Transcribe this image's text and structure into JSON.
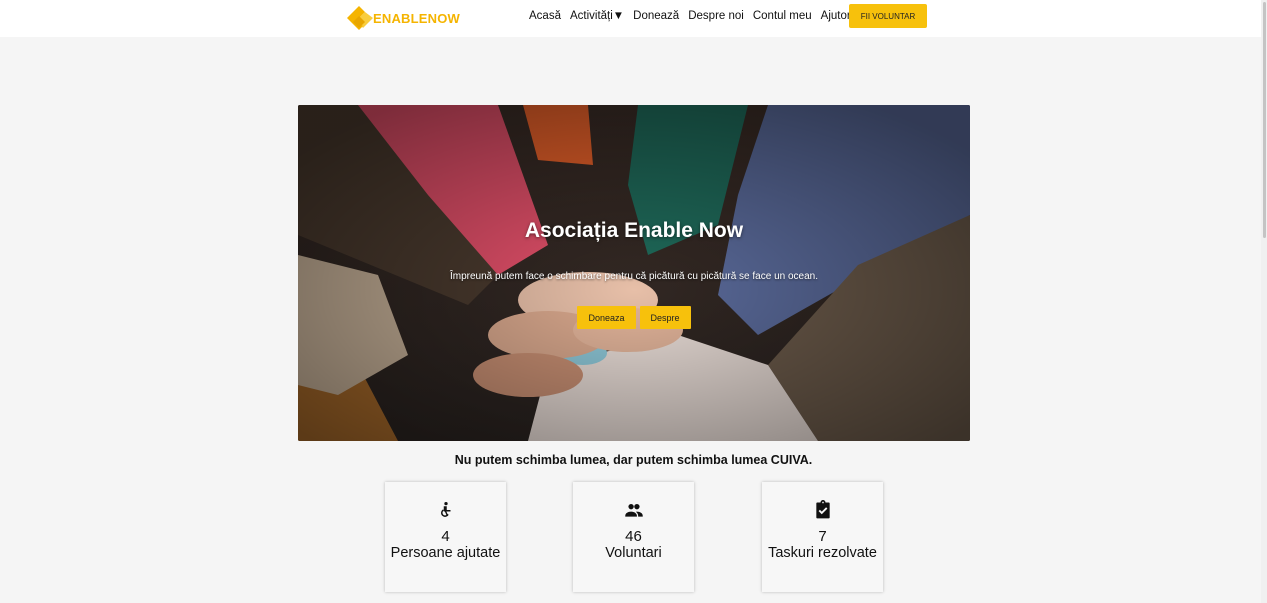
{
  "header": {
    "logo_text": "ENABLENOW",
    "brand_color": "#f7c10c",
    "nav": [
      {
        "label": "Acasă"
      },
      {
        "label": "Activități▼"
      },
      {
        "label": "Donează"
      },
      {
        "label": "Despre noi"
      },
      {
        "label": "Contul meu"
      },
      {
        "label": "Ajutor"
      }
    ],
    "cta_label": "FII VOLUNTAR"
  },
  "hero": {
    "title": "Asociația Enable Now",
    "subtitle": "Împreună putem face o schimbare pentru că picătură cu picătură se face un ocean.",
    "buttons": [
      {
        "label": "Doneaza"
      },
      {
        "label": "Despre"
      }
    ]
  },
  "tagline": "Nu putem schimba lumea, dar putem schimba lumea CUIVA.",
  "stats": [
    {
      "icon": "accessible-icon",
      "value": "4",
      "label": "Persoane ajutate"
    },
    {
      "icon": "people-icon",
      "value": "46",
      "label": "Voluntari"
    },
    {
      "icon": "assignment-check-icon",
      "value": "7",
      "label": "Taskuri rezolvate"
    }
  ]
}
